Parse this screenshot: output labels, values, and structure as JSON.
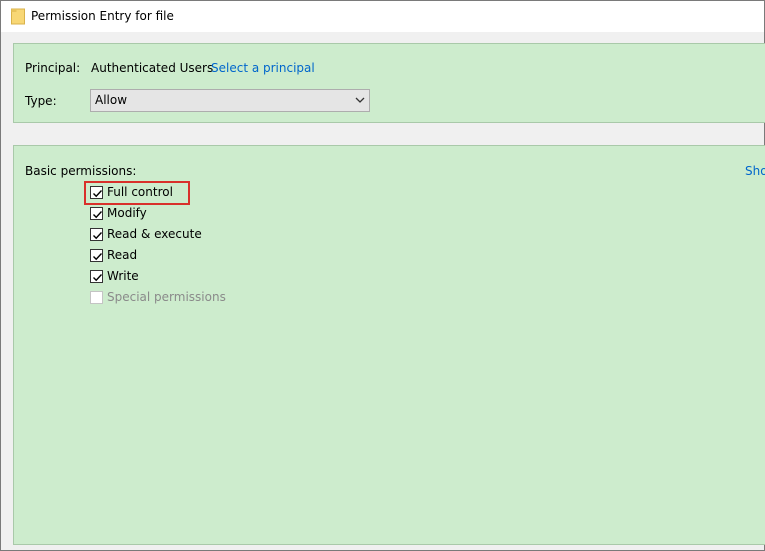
{
  "window": {
    "title": "Permission Entry for file"
  },
  "principal": {
    "label": "Principal:",
    "value": "Authenticated Users",
    "select_link": "Select a principal"
  },
  "type": {
    "label": "Type:",
    "selected": "Allow"
  },
  "permissions": {
    "heading": "Basic permissions:",
    "show_link": "Sho",
    "items": [
      {
        "label": "Full control",
        "checked": true,
        "enabled": true
      },
      {
        "label": "Modify",
        "checked": true,
        "enabled": true
      },
      {
        "label": "Read & execute",
        "checked": true,
        "enabled": true
      },
      {
        "label": "Read",
        "checked": true,
        "enabled": true
      },
      {
        "label": "Write",
        "checked": true,
        "enabled": true
      },
      {
        "label": "Special permissions",
        "checked": false,
        "enabled": false
      }
    ]
  },
  "colors": {
    "panel_bg": "#cdeccd",
    "link": "#0066cc",
    "highlight": "#d9302b"
  }
}
